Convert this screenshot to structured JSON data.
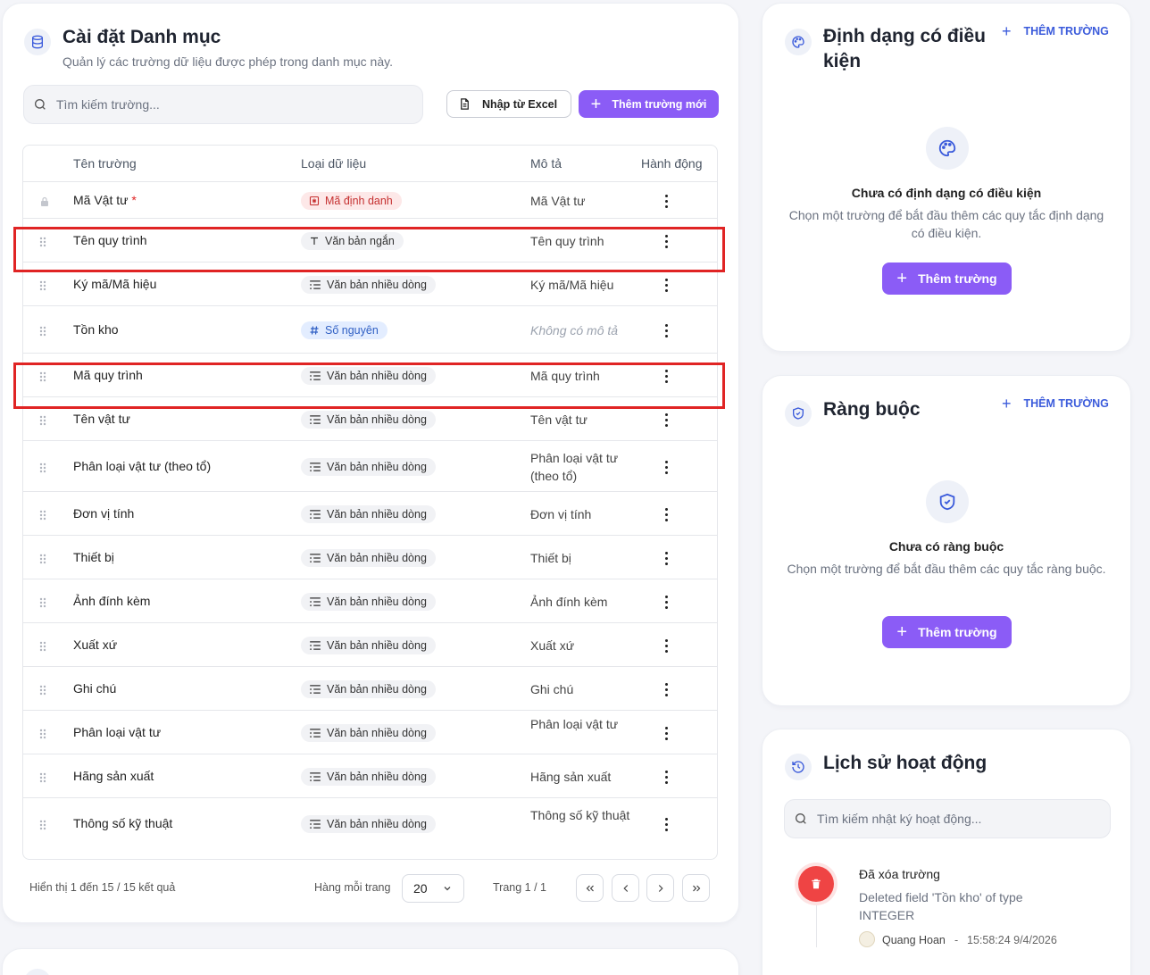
{
  "main": {
    "title": "Cài đặt Danh mục",
    "subtitle": "Quản lý các trường dữ liệu được phép trong danh mục này.",
    "search_placeholder": "Tìm kiếm trường...",
    "import_label": "Nhập từ Excel",
    "add_label": "Thêm trường mới",
    "columns": [
      "Tên trường",
      "Loại dữ liệu",
      "Mô tả",
      "Hành động"
    ],
    "required_mark": "*",
    "rows": [
      {
        "name": "Mã Vật tư",
        "type": "Mã định danh",
        "type_icon": "id-card-icon",
        "desc": "Mã Vật tư",
        "locked": true,
        "required": true
      },
      {
        "name": "Tên quy trình",
        "type": "Văn bản ngắn",
        "type_icon": "text-t-icon",
        "desc": "Tên quy trình",
        "highlighted": true
      },
      {
        "name": "Ký mã/Mã hiệu",
        "type": "Văn bản nhiều dòng",
        "type_icon": "multiline-text-icon",
        "desc": "Ký mã/Mã hiệu"
      },
      {
        "name": "Tồn kho",
        "type": "Số nguyên",
        "type_icon": "hash-icon",
        "desc": "Không có mô tả",
        "no_desc": true
      },
      {
        "name": "Mã quy trình",
        "type": "Văn bản nhiều dòng",
        "type_icon": "multiline-text-icon",
        "desc": "Mã quy trình",
        "highlighted": true
      },
      {
        "name": "Tên vật tư",
        "type": "Văn bản nhiều dòng",
        "type_icon": "multiline-text-icon",
        "desc": "Tên vật tư"
      },
      {
        "name": "Phân loại vật tư (theo tổ)",
        "type": "Văn bản nhiều dòng",
        "type_icon": "multiline-text-icon",
        "desc": "Phân loại vật tư (theo tổ)"
      },
      {
        "name": "Đơn vị tính",
        "type": "Văn bản nhiều dòng",
        "type_icon": "multiline-text-icon",
        "desc": "Đơn vị tính"
      },
      {
        "name": "Thiết bị",
        "type": "Văn bản nhiều dòng",
        "type_icon": "multiline-text-icon",
        "desc": "Thiết bị"
      },
      {
        "name": "Ảnh đính kèm",
        "type": "Văn bản nhiều dòng",
        "type_icon": "multiline-text-icon",
        "desc": "Ảnh đính kèm"
      },
      {
        "name": "Xuất xứ",
        "type": "Văn bản nhiều dòng",
        "type_icon": "multiline-text-icon",
        "desc": "Xuất xứ"
      },
      {
        "name": "Ghi chú",
        "type": "Văn bản nhiều dòng",
        "type_icon": "multiline-text-icon",
        "desc": "Ghi chú"
      },
      {
        "name": "Phân loại vật tư",
        "type": "Văn bản nhiều dòng",
        "type_icon": "multiline-text-icon",
        "desc": "Phân loại vật tư"
      },
      {
        "name": "Hãng sản xuất",
        "type": "Văn bản nhiều dòng",
        "type_icon": "multiline-text-icon",
        "desc": "Hãng sản xuất"
      },
      {
        "name": "Thông số kỹ thuật",
        "type": "Văn bản nhiều dòng",
        "type_icon": "multiline-text-icon",
        "desc": "Thông số kỹ thuật"
      }
    ],
    "pagination": {
      "summary": "Hiển thị 1 đến 15 / 15 kết quả",
      "per_page_label": "Hàng mỗi trang",
      "per_page": "20",
      "page_info": "Trang 1 / 1"
    }
  },
  "conditional": {
    "title": "Định dạng có điều kiện",
    "add_link": "THÊM TRƯỜNG",
    "empty_title": "Chưa có định dạng có điều kiện",
    "empty_desc": "Chọn một trường để bắt đầu thêm các quy tắc định dạng có điều kiện.",
    "button": "Thêm trường"
  },
  "constraints": {
    "title": "Ràng buộc",
    "add_link": "THÊM TRƯỜNG",
    "empty_title": "Chưa có ràng buộc",
    "empty_desc": "Chọn một trường để bắt đầu thêm các quy tắc ràng buộc.",
    "button": "Thêm trường"
  },
  "history": {
    "title": "Lịch sử hoạt động",
    "search_placeholder": "Tìm kiếm nhật ký hoạt động...",
    "entries": [
      {
        "action": "Đã xóa trường",
        "detail": "Deleted field 'Tồn kho' of type INTEGER",
        "user": "Quang Hoan",
        "separator": "-",
        "time": "15:58:24 9/4/2026"
      }
    ]
  },
  "colors": {
    "accent": "#8b5cf6",
    "link": "#3b5bdb",
    "highlight": "#e02424",
    "danger": "#ef4444"
  }
}
